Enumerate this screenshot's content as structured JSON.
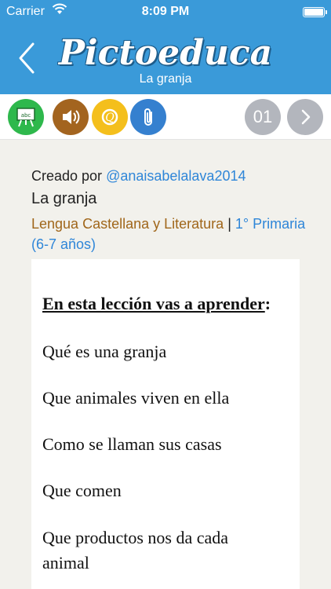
{
  "status_bar": {
    "carrier": "Carrier",
    "time": "8:09 PM"
  },
  "nav": {
    "logo": "Pictoeduca",
    "subtitle": "La granja"
  },
  "toolbar": {
    "board_icon_label": "abc",
    "page_number": "01",
    "colors": {
      "board": "#2eb84c",
      "sound": "#a3641f",
      "quiz": "#f4bf1c",
      "attach": "#3580cf",
      "pager": "#b3b6bd"
    }
  },
  "lesson": {
    "created_by_label": "Creado por",
    "author": "@anaisabelalava2014",
    "title": "La granja",
    "subject": "Lengua Castellana y Literatura",
    "separator": "|",
    "level": "1° Primaria (6-7 años)"
  },
  "card": {
    "heading": "En esta lección vas a aprender",
    "heading_colon": ":",
    "items": [
      "Qué es una granja",
      "Que animales viven en ella",
      "Como se llaman sus casas",
      "Que comen",
      "Que productos nos da cada animal"
    ]
  },
  "colors": {
    "header": "#3a9ad9",
    "link": "#2f86d8",
    "subject": "#a0661a",
    "background": "#f2f1ec"
  }
}
